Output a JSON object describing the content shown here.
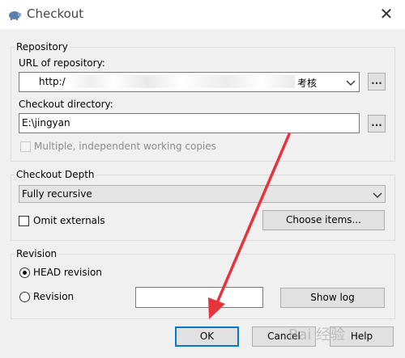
{
  "window": {
    "title": "Checkout",
    "close_glyph": "✕"
  },
  "repository": {
    "group_label": "Repository",
    "url_label": "URL of repository:",
    "url_value_start": "http:/",
    "url_value_end": "考核",
    "browse_label": "...",
    "dir_label": "Checkout directory:",
    "dir_value": "E:\\jingyan",
    "dir_browse_label": "...",
    "multi_copies_label": "Multiple, independent working copies"
  },
  "depth": {
    "group_label": "Checkout Depth",
    "selected": "Fully recursive",
    "omit_externals_label": "Omit externals",
    "choose_items_label": "Choose items..."
  },
  "revision": {
    "group_label": "Revision",
    "head_label": "HEAD revision",
    "revision_label": "Revision",
    "revision_value": "",
    "show_log_label": "Show log"
  },
  "buttons": {
    "ok": "OK",
    "cancel": "Cancel",
    "help": "Help"
  },
  "annotation": {
    "arrow_color": "#e8323c"
  },
  "watermark": {
    "text": "Bai 经验"
  }
}
